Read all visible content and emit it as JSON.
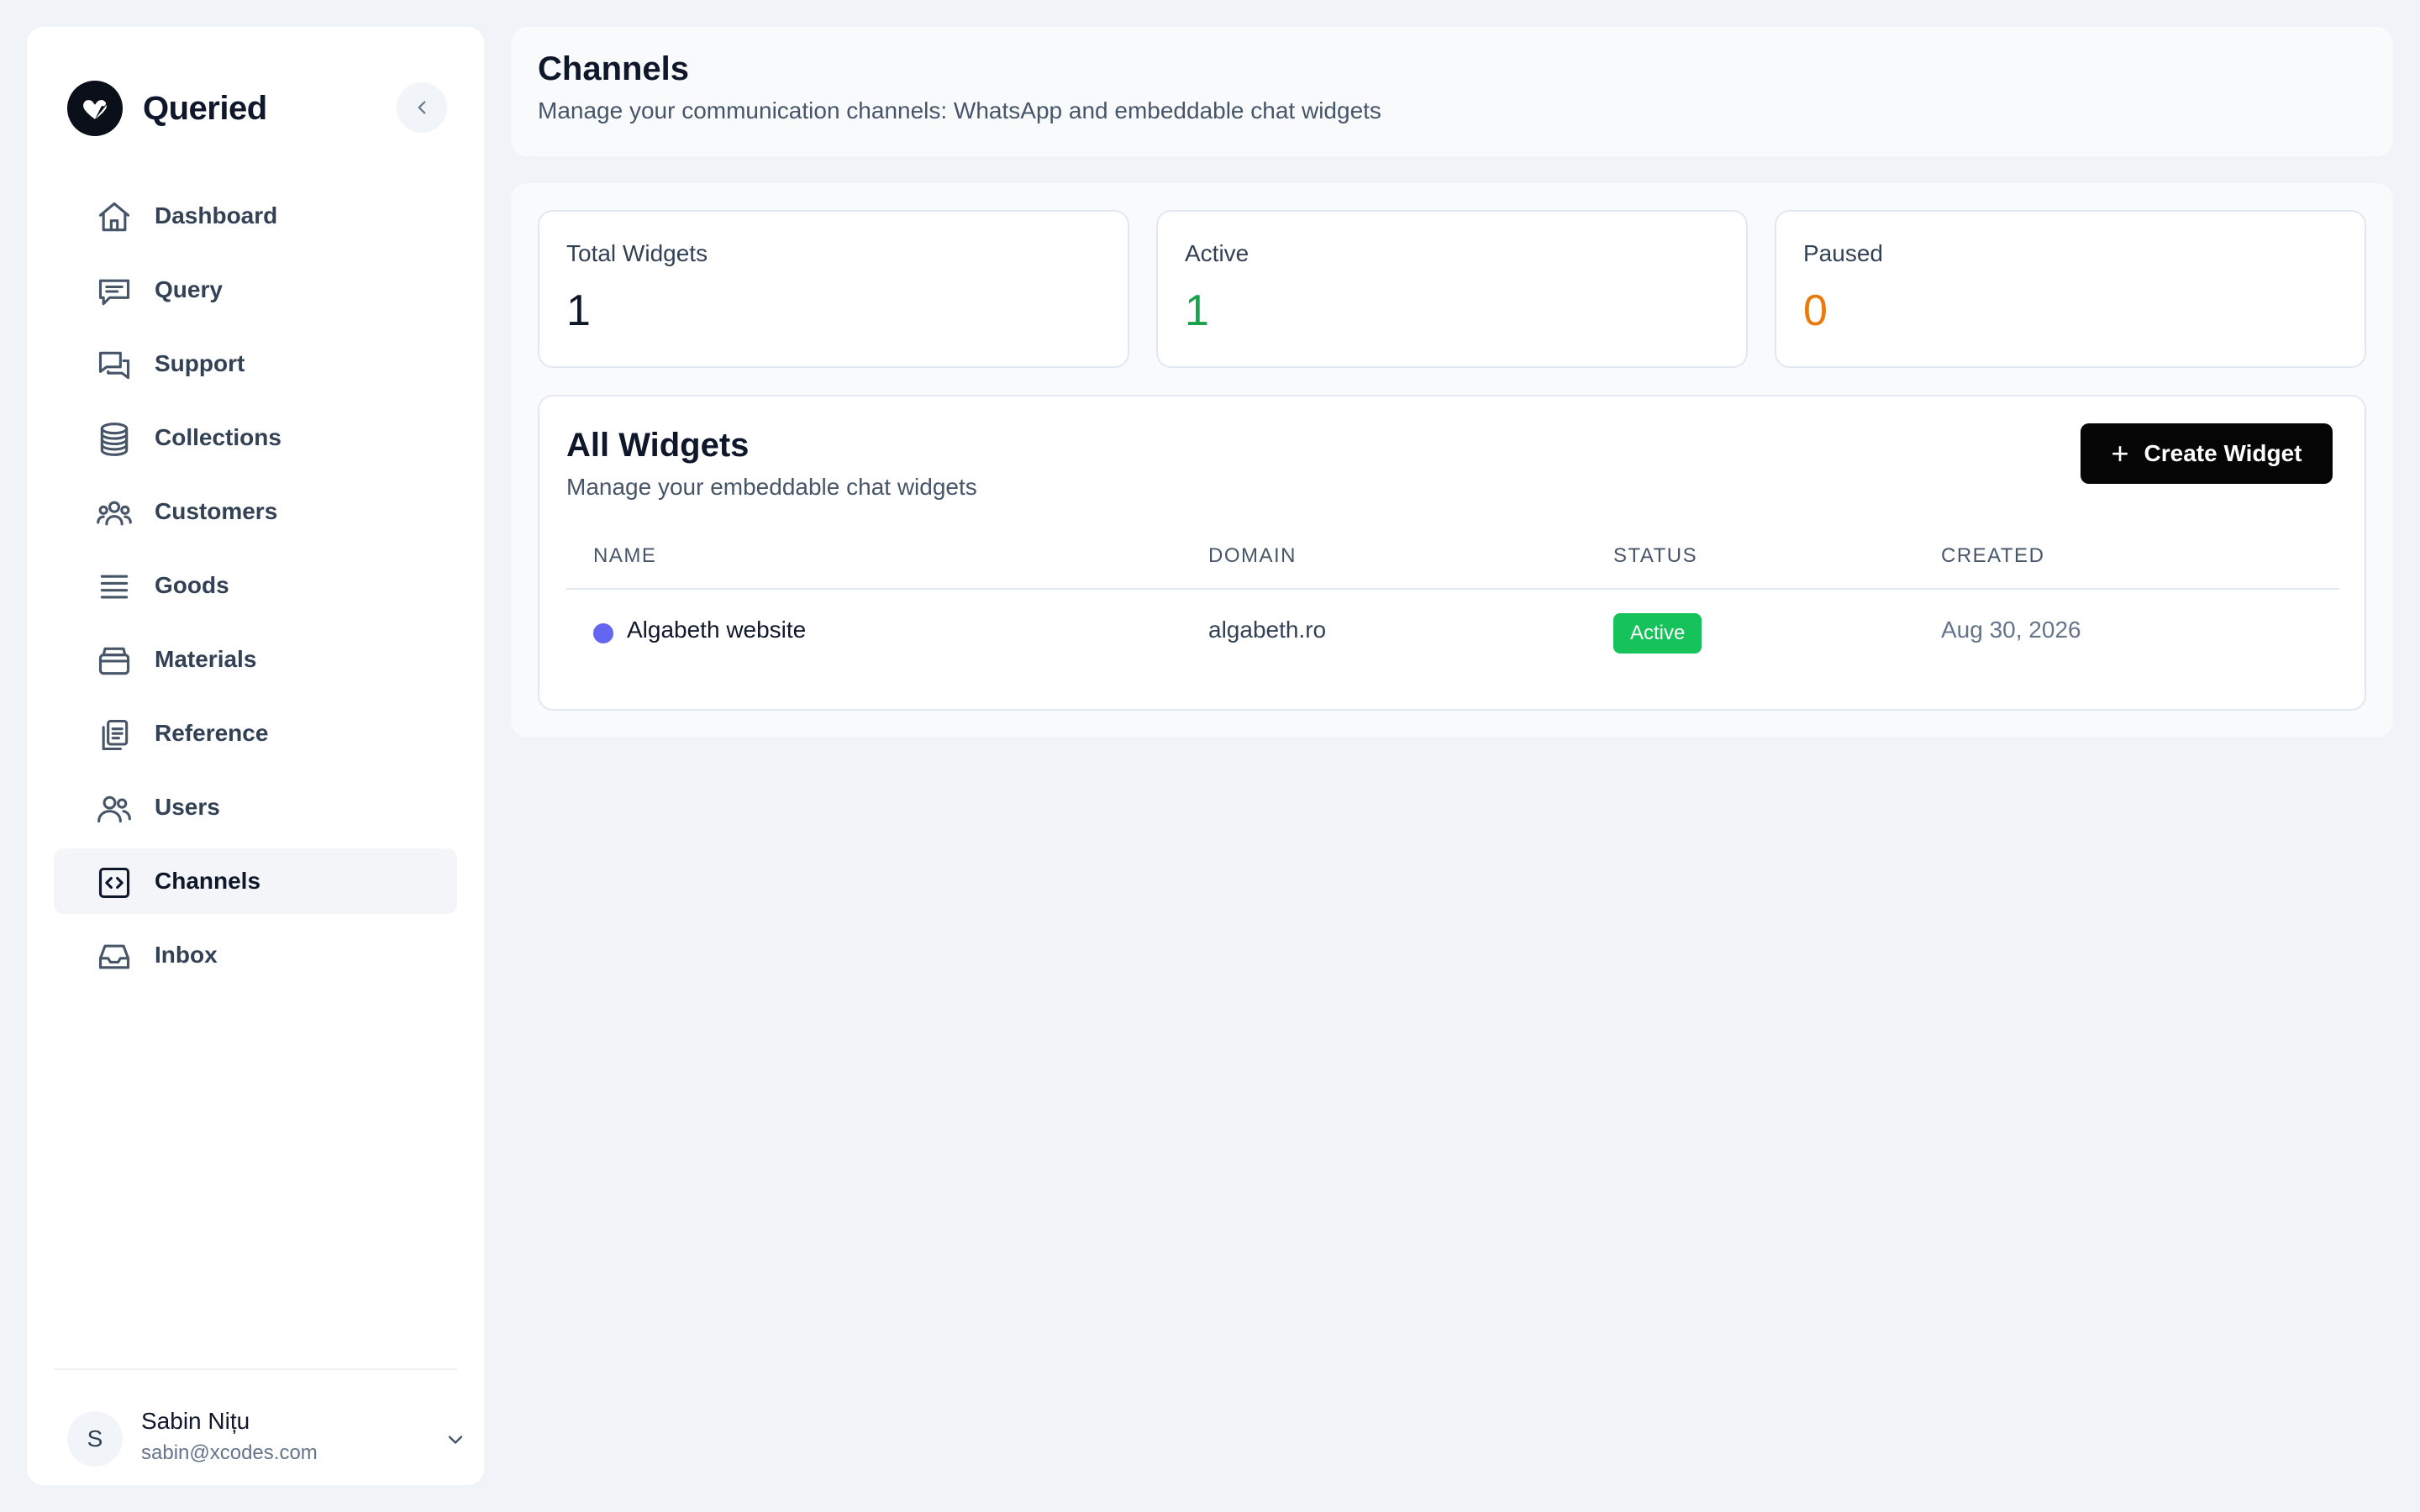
{
  "app": {
    "name": "Queried"
  },
  "sidebar": {
    "items": [
      {
        "label": "Dashboard",
        "icon": "home-icon"
      },
      {
        "label": "Query",
        "icon": "message-square-icon"
      },
      {
        "label": "Support",
        "icon": "messages-icon"
      },
      {
        "label": "Collections",
        "icon": "database-icon"
      },
      {
        "label": "Customers",
        "icon": "users-group-icon"
      },
      {
        "label": "Goods",
        "icon": "list-icon"
      },
      {
        "label": "Materials",
        "icon": "archive-icon"
      },
      {
        "label": "Reference",
        "icon": "clipboard-copy-icon"
      },
      {
        "label": "Users",
        "icon": "users-icon"
      },
      {
        "label": "Channels",
        "icon": "code-square-icon",
        "active": true
      },
      {
        "label": "Inbox",
        "icon": "inbox-icon"
      }
    ],
    "user": {
      "initial": "S",
      "name": "Sabin Nițu",
      "email": "sabin@xcodes.com"
    }
  },
  "header": {
    "title": "Channels",
    "subtitle": "Manage your communication channels: WhatsApp and embeddable chat widgets"
  },
  "stats": [
    {
      "label": "Total Widgets",
      "value": "1",
      "color": "#0f172a"
    },
    {
      "label": "Active",
      "value": "1",
      "color": "#16a34a"
    },
    {
      "label": "Paused",
      "value": "0",
      "color": "#ea7a0c"
    }
  ],
  "widgets": {
    "title": "All Widgets",
    "subtitle": "Manage your embeddable chat widgets",
    "create_label": "Create Widget",
    "columns": [
      "NAME",
      "DOMAIN",
      "STATUS",
      "CREATED"
    ],
    "rows": [
      {
        "name": "Algabeth website",
        "domain": "algabeth.ro",
        "status": "Active",
        "created": "Aug 30, 2026",
        "color": "#6366f1"
      }
    ]
  },
  "colors": {
    "accent": "#050505",
    "status_active": "#16c35a"
  }
}
